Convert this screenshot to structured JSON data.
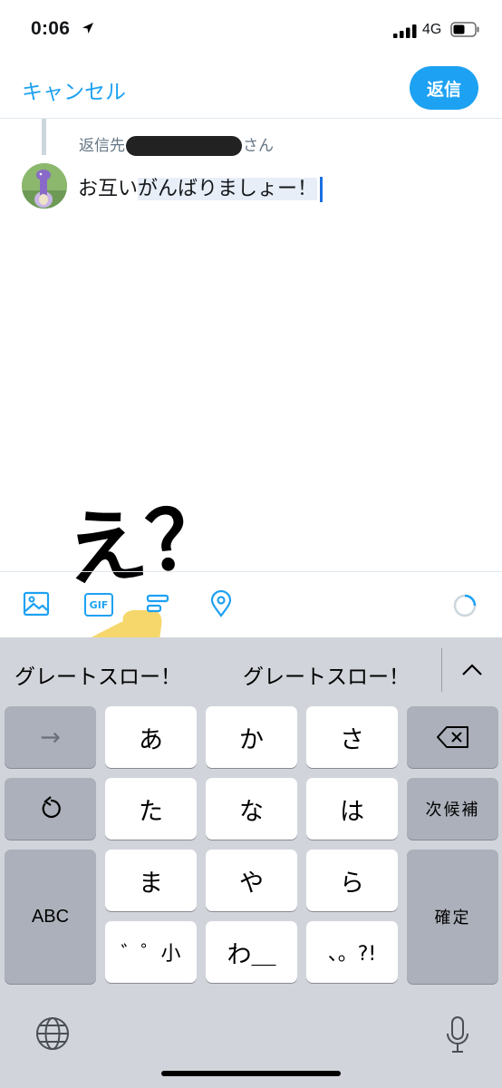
{
  "status_bar": {
    "time": "0:06",
    "network": "4G"
  },
  "nav": {
    "cancel_label": "キャンセル",
    "reply_label": "返信"
  },
  "compose": {
    "replying_prefix": "返信先",
    "replying_suffix": "さん",
    "text_plain": "お互い",
    "text_selected": "がんばりましょー！"
  },
  "overlay": {
    "text": "え？"
  },
  "toolbar": {
    "icons": [
      "image-icon",
      "gif-icon",
      "poll-icon",
      "location-icon",
      "progress-ring-icon"
    ],
    "gif_label": "GIF"
  },
  "keyboard": {
    "suggestions": [
      "グレートスロー！",
      "グレートスロー！"
    ],
    "keys": {
      "arrow": "→",
      "a": "あ",
      "ka": "か",
      "sa": "さ",
      "ta": "た",
      "na": "な",
      "ha": "は",
      "next_candidate": "次候補",
      "abc": "ABC",
      "ma": "ま",
      "ya": "や",
      "ra": "ら",
      "confirm": "確定",
      "dakuten": "゛゜小",
      "wa": "わ＿",
      "punct": "、。?!"
    }
  },
  "colors": {
    "accent": "#1da1f2",
    "keyboard_bg": "#d1d4da",
    "dark_key": "#abb0ba",
    "selection": "#e8eef8",
    "caret": "#1d6fe0",
    "finger": "#f6d76b"
  }
}
